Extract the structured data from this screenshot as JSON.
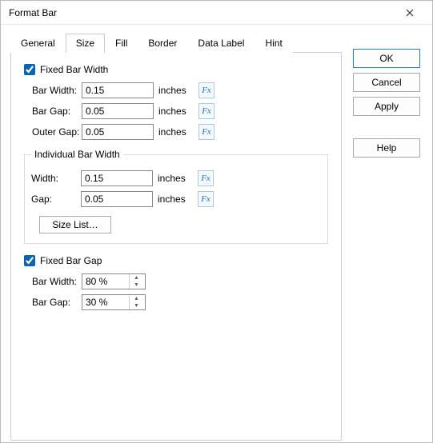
{
  "title": "Format Bar",
  "tabs": {
    "general": "General",
    "size": "Size",
    "fill": "Fill",
    "border": "Border",
    "dataLabel": "Data Label",
    "hint": "Hint"
  },
  "section1": {
    "checkLabel": "Fixed Bar Width",
    "rows": {
      "barWidth": {
        "label": "Bar Width:",
        "value": "0.15",
        "unit": "inches"
      },
      "barGap": {
        "label": "Bar Gap:",
        "value": "0.05",
        "unit": "inches"
      },
      "outerGap": {
        "label": "Outer Gap:",
        "value": "0.05",
        "unit": "inches"
      }
    }
  },
  "group": {
    "legend": "Individual Bar Width",
    "rows": {
      "width": {
        "label": "Width:",
        "value": "0.15",
        "unit": "inches"
      },
      "gap": {
        "label": "Gap:",
        "value": "0.05",
        "unit": "inches"
      }
    },
    "sizeListBtn": "Size List…"
  },
  "section2": {
    "checkLabel": "Fixed Bar Gap",
    "rows": {
      "barWidth": {
        "label": "Bar Width:",
        "value": "80 %"
      },
      "barGap": {
        "label": "Bar Gap:",
        "value": "30 %"
      }
    }
  },
  "buttons": {
    "ok": "OK",
    "cancel": "Cancel",
    "apply": "Apply",
    "help": "Help"
  },
  "fx": "Fx"
}
